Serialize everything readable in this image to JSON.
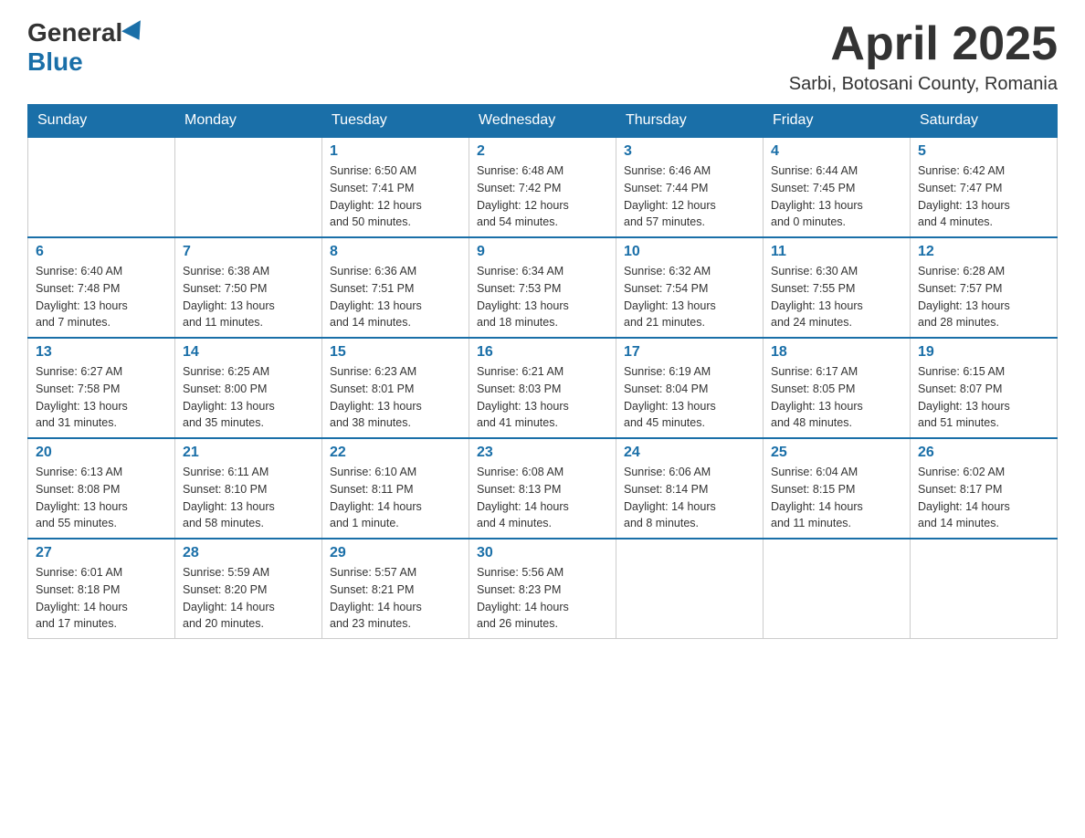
{
  "header": {
    "logo_general": "General",
    "logo_blue": "Blue",
    "month_title": "April 2025",
    "location": "Sarbi, Botosani County, Romania"
  },
  "days_of_week": [
    "Sunday",
    "Monday",
    "Tuesday",
    "Wednesday",
    "Thursday",
    "Friday",
    "Saturday"
  ],
  "weeks": [
    [
      {
        "day": "",
        "info": ""
      },
      {
        "day": "",
        "info": ""
      },
      {
        "day": "1",
        "info": "Sunrise: 6:50 AM\nSunset: 7:41 PM\nDaylight: 12 hours\nand 50 minutes."
      },
      {
        "day": "2",
        "info": "Sunrise: 6:48 AM\nSunset: 7:42 PM\nDaylight: 12 hours\nand 54 minutes."
      },
      {
        "day": "3",
        "info": "Sunrise: 6:46 AM\nSunset: 7:44 PM\nDaylight: 12 hours\nand 57 minutes."
      },
      {
        "day": "4",
        "info": "Sunrise: 6:44 AM\nSunset: 7:45 PM\nDaylight: 13 hours\nand 0 minutes."
      },
      {
        "day": "5",
        "info": "Sunrise: 6:42 AM\nSunset: 7:47 PM\nDaylight: 13 hours\nand 4 minutes."
      }
    ],
    [
      {
        "day": "6",
        "info": "Sunrise: 6:40 AM\nSunset: 7:48 PM\nDaylight: 13 hours\nand 7 minutes."
      },
      {
        "day": "7",
        "info": "Sunrise: 6:38 AM\nSunset: 7:50 PM\nDaylight: 13 hours\nand 11 minutes."
      },
      {
        "day": "8",
        "info": "Sunrise: 6:36 AM\nSunset: 7:51 PM\nDaylight: 13 hours\nand 14 minutes."
      },
      {
        "day": "9",
        "info": "Sunrise: 6:34 AM\nSunset: 7:53 PM\nDaylight: 13 hours\nand 18 minutes."
      },
      {
        "day": "10",
        "info": "Sunrise: 6:32 AM\nSunset: 7:54 PM\nDaylight: 13 hours\nand 21 minutes."
      },
      {
        "day": "11",
        "info": "Sunrise: 6:30 AM\nSunset: 7:55 PM\nDaylight: 13 hours\nand 24 minutes."
      },
      {
        "day": "12",
        "info": "Sunrise: 6:28 AM\nSunset: 7:57 PM\nDaylight: 13 hours\nand 28 minutes."
      }
    ],
    [
      {
        "day": "13",
        "info": "Sunrise: 6:27 AM\nSunset: 7:58 PM\nDaylight: 13 hours\nand 31 minutes."
      },
      {
        "day": "14",
        "info": "Sunrise: 6:25 AM\nSunset: 8:00 PM\nDaylight: 13 hours\nand 35 minutes."
      },
      {
        "day": "15",
        "info": "Sunrise: 6:23 AM\nSunset: 8:01 PM\nDaylight: 13 hours\nand 38 minutes."
      },
      {
        "day": "16",
        "info": "Sunrise: 6:21 AM\nSunset: 8:03 PM\nDaylight: 13 hours\nand 41 minutes."
      },
      {
        "day": "17",
        "info": "Sunrise: 6:19 AM\nSunset: 8:04 PM\nDaylight: 13 hours\nand 45 minutes."
      },
      {
        "day": "18",
        "info": "Sunrise: 6:17 AM\nSunset: 8:05 PM\nDaylight: 13 hours\nand 48 minutes."
      },
      {
        "day": "19",
        "info": "Sunrise: 6:15 AM\nSunset: 8:07 PM\nDaylight: 13 hours\nand 51 minutes."
      }
    ],
    [
      {
        "day": "20",
        "info": "Sunrise: 6:13 AM\nSunset: 8:08 PM\nDaylight: 13 hours\nand 55 minutes."
      },
      {
        "day": "21",
        "info": "Sunrise: 6:11 AM\nSunset: 8:10 PM\nDaylight: 13 hours\nand 58 minutes."
      },
      {
        "day": "22",
        "info": "Sunrise: 6:10 AM\nSunset: 8:11 PM\nDaylight: 14 hours\nand 1 minute."
      },
      {
        "day": "23",
        "info": "Sunrise: 6:08 AM\nSunset: 8:13 PM\nDaylight: 14 hours\nand 4 minutes."
      },
      {
        "day": "24",
        "info": "Sunrise: 6:06 AM\nSunset: 8:14 PM\nDaylight: 14 hours\nand 8 minutes."
      },
      {
        "day": "25",
        "info": "Sunrise: 6:04 AM\nSunset: 8:15 PM\nDaylight: 14 hours\nand 11 minutes."
      },
      {
        "day": "26",
        "info": "Sunrise: 6:02 AM\nSunset: 8:17 PM\nDaylight: 14 hours\nand 14 minutes."
      }
    ],
    [
      {
        "day": "27",
        "info": "Sunrise: 6:01 AM\nSunset: 8:18 PM\nDaylight: 14 hours\nand 17 minutes."
      },
      {
        "day": "28",
        "info": "Sunrise: 5:59 AM\nSunset: 8:20 PM\nDaylight: 14 hours\nand 20 minutes."
      },
      {
        "day": "29",
        "info": "Sunrise: 5:57 AM\nSunset: 8:21 PM\nDaylight: 14 hours\nand 23 minutes."
      },
      {
        "day": "30",
        "info": "Sunrise: 5:56 AM\nSunset: 8:23 PM\nDaylight: 14 hours\nand 26 minutes."
      },
      {
        "day": "",
        "info": ""
      },
      {
        "day": "",
        "info": ""
      },
      {
        "day": "",
        "info": ""
      }
    ]
  ]
}
